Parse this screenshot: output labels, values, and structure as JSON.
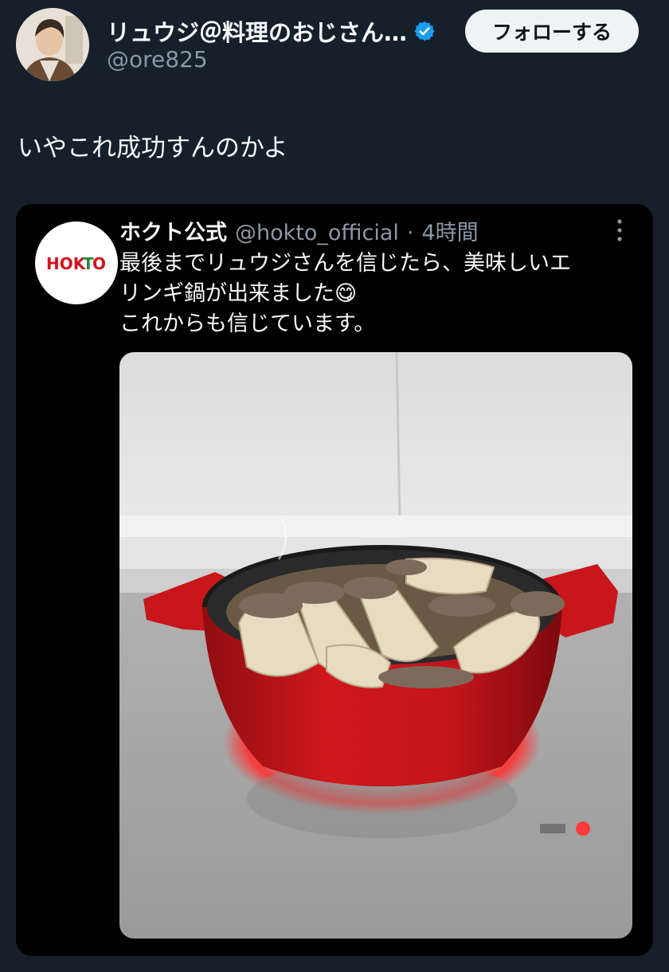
{
  "author": {
    "display_name": "リュウジ＠料理のおじさん…",
    "handle": "@ore825",
    "follow_label": "フォローする"
  },
  "tweet": {
    "text": "いやこれ成功すんのかよ"
  },
  "quoted": {
    "avatar_logo": "HOKTO",
    "display_name": "ホクト公式",
    "handle": "@hokto_official",
    "separator": "·",
    "time": "4時間",
    "lines": [
      "最後までリュウジさんを信じたら、美味しいエ",
      "リンギ鍋が出来ました😋",
      "これからも信じています。"
    ]
  },
  "colors": {
    "background": "#15202b",
    "quote_background": "#000000",
    "verified": "#1d9bf0",
    "pot_red": "#c8161b",
    "text_secondary": "#8b98a5"
  }
}
